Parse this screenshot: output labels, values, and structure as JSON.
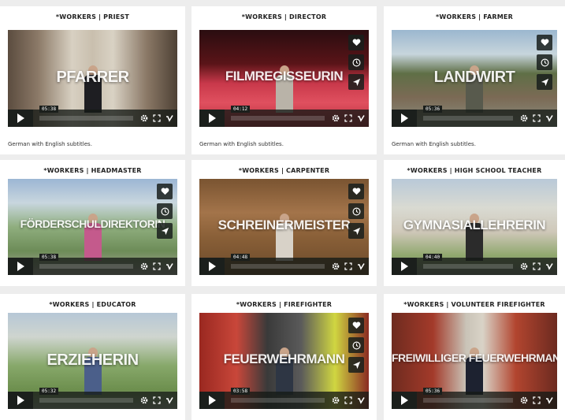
{
  "cards": [
    {
      "title": "*WORKERS | PRIEST",
      "overlay": "PFARRER",
      "time": "05:38",
      "note": "German with English subtitles.",
      "scene": "church",
      "side": false,
      "size": ""
    },
    {
      "title": "*WORKERS | DIRECTOR",
      "overlay": "FILMREGISSEURIN",
      "time": "04:12",
      "note": "German with English subtitles.",
      "scene": "cinema",
      "side": true,
      "size": "med"
    },
    {
      "title": "*WORKERS | FARMER",
      "overlay": "LANDWIRT",
      "time": "05:36",
      "note": "German with English subtitles.",
      "scene": "farm",
      "side": true,
      "size": ""
    },
    {
      "title": "*WORKERS | HEADMASTER",
      "overlay": "FÖRDERSCHULDIREKTORIN",
      "time": "05:38",
      "note": "",
      "scene": "street",
      "side": true,
      "size": "small"
    },
    {
      "title": "*WORKERS | CARPENTER",
      "overlay": "SCHREINERMEISTER",
      "time": "04:48",
      "note": "",
      "scene": "workshop",
      "side": true,
      "size": "med"
    },
    {
      "title": "*WORKERS | HIGH SCHOOL TEACHER",
      "overlay": "GYMNASIALLEHRERIN",
      "time": "04:40",
      "note": "",
      "scene": "school",
      "side": false,
      "size": "med"
    },
    {
      "title": "*WORKERS | EDUCATOR",
      "overlay": "ERZIEHERIN",
      "time": "05:32",
      "note": "",
      "scene": "garden",
      "side": false,
      "size": ""
    },
    {
      "title": "*WORKERS | FIREFIGHTER",
      "overlay": "FEUERWEHRMANN",
      "time": "03:58",
      "note": "",
      "scene": "firestation",
      "side": true,
      "size": "med"
    },
    {
      "title": "*WORKERS | VOLUNTEER FIREFIGHTER",
      "overlay": "FREIWILLIGER FEUERWEHRMANN",
      "time": "05:36",
      "note": "",
      "scene": "firetruck",
      "side": false,
      "size": "small"
    }
  ],
  "icons": {
    "play": "play-icon",
    "settings": "gear-icon",
    "fullscreen": "fullscreen-icon",
    "vimeo": "vimeo-icon",
    "like": "heart-icon",
    "later": "clock-icon",
    "share": "paper-plane-icon"
  },
  "colors": {
    "control_bar": "#1b1f1c",
    "card_bg": "#ffffff",
    "page_bg": "#ededed"
  }
}
